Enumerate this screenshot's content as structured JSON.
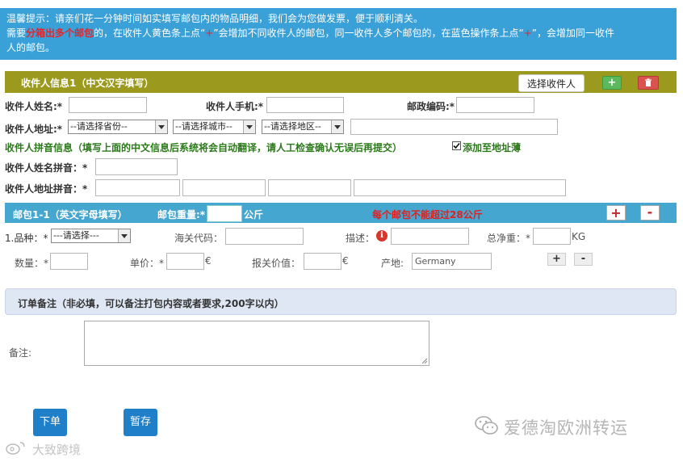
{
  "notice": {
    "line1": "温馨提示：请亲们花一分钟时间如实填写邮包内的物品明细，我们会为您做发票，便于顺利清关。",
    "line2_pre": "需要",
    "line2_red": "分箱出多个邮包",
    "line2_mid": "的，在收件人黄色条上点“",
    "line2_plus1": "+",
    "line2_mid2": "”会增加不同收件人的邮包，同一收件人多个邮包的，在蓝色操作条上点“",
    "line2_plus2": "+",
    "line2_end": "”，会增加同一收件",
    "line3": "人的邮包。"
  },
  "recipient": {
    "header_title": "收件人信息1（中文汉字填写）",
    "select_button": "选择收件人",
    "add_symbol": "+",
    "name_label": "收件人姓名:*",
    "phone_label": "收件人手机:*",
    "zip_label": "邮政编码:*",
    "address_label": "收件人地址:*",
    "province_select": "--请选择省份--",
    "city_select": "--请选择城市--",
    "district_select": "--请选择地区--",
    "pinyin_notice": "收件人拼音信息（填写上面的中文信息后系统将会自动翻译，请人工检查确认无误后再提交）",
    "add_to_book_label": "添加至地址薄",
    "add_to_book_checked": true,
    "name_pinyin_label": "收件人姓名拼音：*",
    "address_pinyin_label": "收件人地址拼音：*"
  },
  "package": {
    "header_title": "邮包1-1（英文字母填写）",
    "weight_label": "邮包重量:*",
    "weight_unit": "公斤",
    "warning": "每个邮包不能超过28公斤",
    "plus": "+",
    "minus": "-",
    "item": {
      "category_label": "1.品种：*",
      "category_select": "---请选择---",
      "customs_code_label": "海关代码：",
      "desc_label": "描述：",
      "net_weight_label": "总净重：*",
      "net_weight_unit": "KG",
      "qty_label": "数量：*",
      "price_label": "单价：*",
      "price_unit": "€",
      "declared_label": "报关价值：",
      "declared_unit": "€",
      "origin_label": "产地:",
      "origin_value": "Germany",
      "plus": "+",
      "minus": "-"
    }
  },
  "order_note": {
    "header_title": "订单备注（非必填，可以备注打包内容或者要求,200字以内）",
    "note_label": "备注:"
  },
  "buttons": {
    "submit": "下单",
    "save_draft": "暂存"
  },
  "watermarks": {
    "right": "爱德淘欧洲转运",
    "left": "大致跨境"
  },
  "colors": {
    "notice_bg": "#3aa0d8",
    "recipient_bar": "#9b9a1e",
    "package_bar": "#45a6cf",
    "order_note_bg": "#dfe6f4",
    "green_text": "#2b7a1a",
    "red_text": "#e02020",
    "button_blue": "#1f7fc8"
  }
}
